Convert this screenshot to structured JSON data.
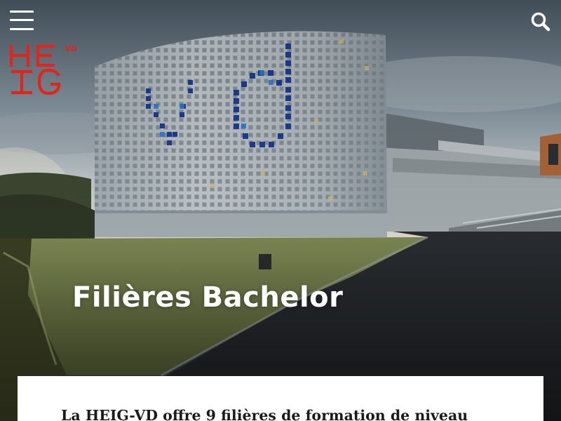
{
  "header": {
    "menu_icon": "hamburger-menu-icon",
    "search_icon": "search-icon"
  },
  "logo": {
    "line1": "HE",
    "line2": "IG",
    "suffix": "VD",
    "color": "#e1251b"
  },
  "hero": {
    "title": "Filières Bachelor",
    "image_description_icon": "campus-building-photo"
  },
  "content": {
    "intro": "La HEIG-VD offre 9 filières de formation de niveau"
  },
  "colors": {
    "accent": "#e1251b",
    "title_text": "#ffffff",
    "card_background": "#ffffff",
    "body_text": "#1b1b1b"
  }
}
